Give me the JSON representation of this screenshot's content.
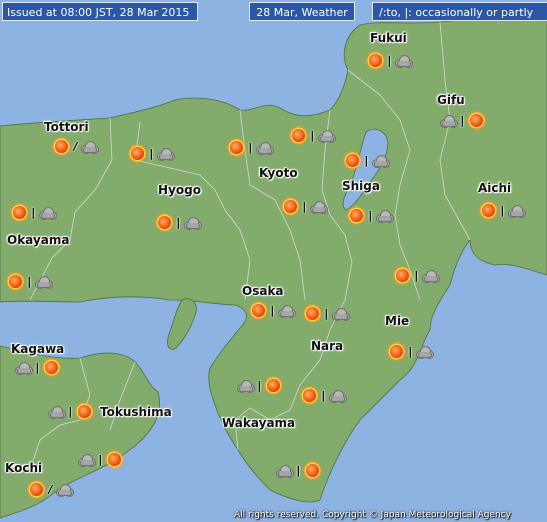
{
  "header": {
    "issued": "Issued at 08:00 JST, 28 Mar 2015",
    "date_weather": "28 Mar, Weather",
    "legend": "/:to,  |: occasionally or partly"
  },
  "prefectures": {
    "fukui": "Fukui",
    "gifu": "Gifu",
    "tottori": "Tottori",
    "kyoto": "Kyoto",
    "shiga": "Shiga",
    "hyogo": "Hyogo",
    "aichi": "Aichi",
    "okayama": "Okayama",
    "osaka": "Osaka",
    "mie": "Mie",
    "nara": "Nara",
    "kagawa": "Kagawa",
    "tokushima": "Tokushima",
    "wakayama": "Wakayama",
    "kochi": "Kochi"
  },
  "forecasts": {
    "fukui": [
      "sun",
      "|",
      "cloud"
    ],
    "gifu": [
      "cloud",
      "|",
      "sun"
    ],
    "tottori": [
      "sun",
      "/",
      "cloud"
    ],
    "tottori_east": [
      "sun",
      "|",
      "cloud"
    ],
    "kyoto_north": [
      "sun",
      "|",
      "cloud"
    ],
    "kyoto_ne": [
      "sun",
      "|",
      "cloud"
    ],
    "shiga_north": [
      "sun",
      "|",
      "cloud"
    ],
    "okayama_north": [
      "sun",
      "|",
      "cloud"
    ],
    "hyogo": [
      "sun",
      "|",
      "cloud"
    ],
    "kyoto_south": [
      "sun",
      "|",
      "cloud"
    ],
    "shiga_south": [
      "sun",
      "|",
      "cloud"
    ],
    "aichi": [
      "sun",
      "|",
      "cloud"
    ],
    "mie_north": [
      "sun",
      "|",
      "cloud"
    ],
    "okayama_south": [
      "sun",
      "|",
      "cloud"
    ],
    "osaka": [
      "sun",
      "|",
      "cloud"
    ],
    "nara_north": [
      "sun",
      "|",
      "cloud"
    ],
    "mie_south": [
      "sun",
      "|",
      "cloud"
    ],
    "kagawa": [
      "cloud",
      "|",
      "sun"
    ],
    "wakayama_north": [
      "cloud",
      "|",
      "sun"
    ],
    "nara_south": [
      "sun",
      "|",
      "cloud"
    ],
    "tokushima_north": [
      "cloud",
      "|",
      "sun"
    ],
    "tokushima_south": [
      "cloud",
      "|",
      "sun"
    ],
    "wakayama_south": [
      "cloud",
      "|",
      "sun"
    ],
    "kochi": [
      "sun",
      "/",
      "cloud"
    ]
  },
  "copyright": "All rights reserved. Copyright © Japan Meteorological Agency",
  "colors": {
    "sea": "#8db3e2",
    "land": "#82ab6c",
    "header": "#2a57a6"
  }
}
